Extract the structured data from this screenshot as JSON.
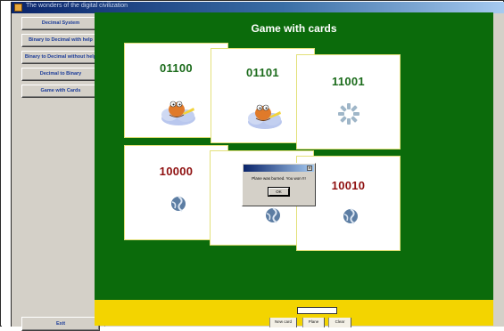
{
  "window": {
    "title": "The wonders of the digital civilization"
  },
  "sidebar": {
    "items": [
      {
        "label": "Decimal System"
      },
      {
        "label": "Binary to Decimal with help"
      },
      {
        "label": "Binary to Decimal without help"
      },
      {
        "label": "Decimal to Binary"
      },
      {
        "label": "Game with Cards"
      }
    ],
    "exit_label": "Exit"
  },
  "game": {
    "title": "Game with cards",
    "cards": [
      {
        "code": "01100",
        "icon": "frog-on-cloud-icon",
        "color": "#1b6b1b"
      },
      {
        "code": "01101",
        "icon": "frog-on-cloud-icon",
        "color": "#1b6b1b"
      },
      {
        "code": "11001",
        "icon": "spinner-wheel-icon",
        "color": "#1b6b1b"
      },
      {
        "code": "10000",
        "icon": "blue-swirl-icon",
        "color": "#8f1010"
      },
      {
        "code": "",
        "icon": "blue-swirl-icon",
        "color": "#8f1010"
      },
      {
        "code": "10010",
        "icon": "blue-swirl-icon",
        "color": "#8f1010"
      }
    ]
  },
  "dialog": {
    "title": "",
    "message": "Plane was burned. You won !!!",
    "ok_label": "OK"
  },
  "footer": {
    "answer_value": "",
    "buttons": [
      {
        "label": "New card"
      },
      {
        "label": "Plane"
      },
      {
        "label": "Clear"
      }
    ]
  },
  "colors": {
    "stage": "#0b6b0b",
    "footer": "#f3d400",
    "card_border": "#e3e07a",
    "green_text": "#1b6b1b",
    "red_text": "#8f1010"
  }
}
